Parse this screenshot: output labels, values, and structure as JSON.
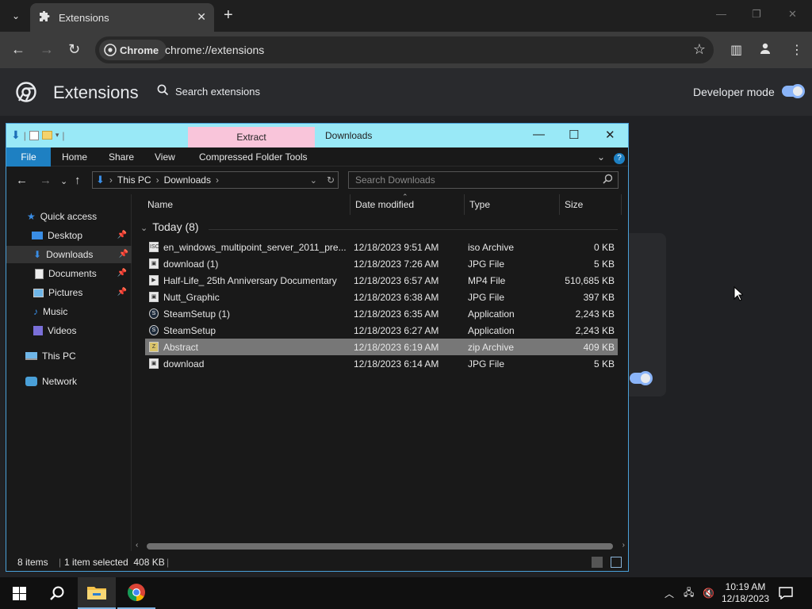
{
  "chrome": {
    "tab_title": "Extensions",
    "tab_close": "✕",
    "new_tab": "+",
    "chip_label": "Chrome",
    "url": "chrome://extensions"
  },
  "extensions_page": {
    "title": "Extensions",
    "search_placeholder": "Search extensions",
    "developer_mode_label": "Developer mode",
    "developer_mode_on": true
  },
  "explorer": {
    "title": "Downloads",
    "contextual_tab": "Extract",
    "ribbon_tabs": [
      "File",
      "Home",
      "Share",
      "View",
      "Compressed Folder Tools"
    ],
    "breadcrumb": [
      "This PC",
      "Downloads"
    ],
    "search_placeholder": "Search Downloads",
    "nav": {
      "quick_access": "Quick access",
      "desktop": "Desktop",
      "downloads": "Downloads",
      "documents": "Documents",
      "pictures": "Pictures",
      "music": "Music",
      "videos": "Videos",
      "this_pc": "This PC",
      "network": "Network"
    },
    "columns": {
      "name": "Name",
      "date": "Date modified",
      "type": "Type",
      "size": "Size"
    },
    "group_label": "Today (8)",
    "files": [
      {
        "name": "en_windows_multipoint_server_2011_pre...",
        "date": "12/18/2023 9:51 AM",
        "type": "iso Archive",
        "size": "0 KB",
        "icon": "iso-file-icon"
      },
      {
        "name": "download (1)",
        "date": "12/18/2023 7:26 AM",
        "type": "JPG File",
        "size": "5 KB",
        "icon": "jpg-file-icon"
      },
      {
        "name": "Half-Life_ 25th Anniversary Documentary",
        "date": "12/18/2023 6:57 AM",
        "type": "MP4 File",
        "size": "510,685 KB",
        "icon": "mp4-file-icon"
      },
      {
        "name": "Nutt_Graphic",
        "date": "12/18/2023 6:38 AM",
        "type": "JPG File",
        "size": "397 KB",
        "icon": "jpg-file-icon"
      },
      {
        "name": "SteamSetup (1)",
        "date": "12/18/2023 6:35 AM",
        "type": "Application",
        "size": "2,243 KB",
        "icon": "steam-app-icon"
      },
      {
        "name": "SteamSetup",
        "date": "12/18/2023 6:27 AM",
        "type": "Application",
        "size": "2,243 KB",
        "icon": "steam-app-icon"
      },
      {
        "name": "Abstract",
        "date": "12/18/2023 6:19 AM",
        "type": "zip Archive",
        "size": "409 KB",
        "icon": "zip-file-icon",
        "selected": true
      },
      {
        "name": "download",
        "date": "12/18/2023 6:14 AM",
        "type": "JPG File",
        "size": "5 KB",
        "icon": "jpg-file-icon"
      }
    ],
    "status": {
      "items": "8 items",
      "selected": "1 item selected  408 KB"
    }
  },
  "taskbar": {
    "time": "10:19 AM",
    "date": "12/18/2023"
  },
  "colors": {
    "explorer_titlebar": "#99e9f7",
    "extract_tab": "#f9c5da",
    "file_tab": "#1e80c2",
    "toggle_accent": "#8ab4f8"
  }
}
